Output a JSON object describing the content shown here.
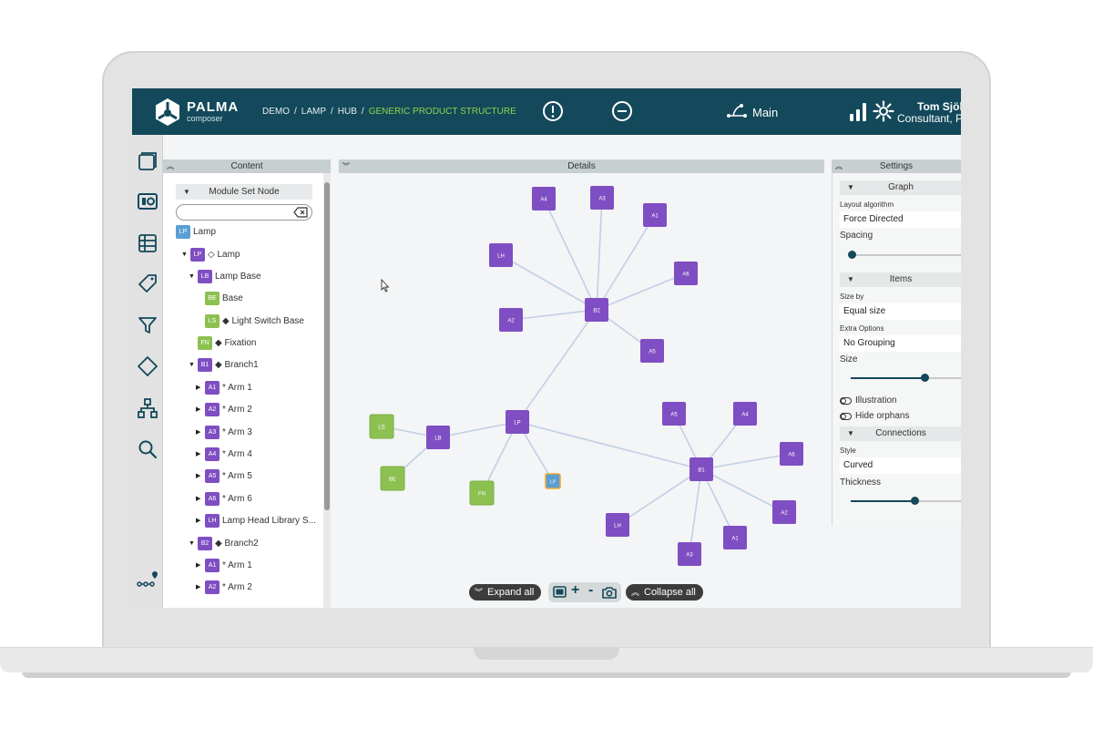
{
  "app": {
    "brand": "PALMA",
    "brand_sub": "composer"
  },
  "breadcrumb": {
    "items": [
      "DEMO",
      "LAMP",
      "HUB"
    ],
    "current": "GENERIC PRODUCT STRUCTURE"
  },
  "header": {
    "branch_label": "Main",
    "user_name": "Tom Sjöb",
    "user_role": "Consultant, P"
  },
  "rail": {
    "icons": [
      "modules-icon",
      "dashboard-icon",
      "table-icon",
      "tag-icon",
      "filter-icon",
      "diamond-icon",
      "hierarchy-icon",
      "search-icon",
      "roadmap-icon"
    ]
  },
  "content": {
    "title": "Content",
    "module_head": "Module Set Node",
    "search_placeholder": "",
    "tree": [
      {
        "badge": "LP",
        "color": "#5a9fd4",
        "label": "Lamp",
        "caret": "",
        "indent": 0
      },
      {
        "badge": "LP",
        "color": "#7f4ec2",
        "label": "◇ Lamp",
        "caret": "▼",
        "indent": 1
      },
      {
        "badge": "LB",
        "color": "#7f4ec2",
        "label": "Lamp Base",
        "caret": "▼",
        "indent": 2
      },
      {
        "badge": "BE",
        "color": "#8cc152",
        "label": "Base",
        "caret": "",
        "indent": 3
      },
      {
        "badge": "LS",
        "color": "#8cc152",
        "label": "◆ Light Switch Base",
        "caret": "",
        "indent": 3
      },
      {
        "badge": "FN",
        "color": "#8cc152",
        "label": "◆ Fixation",
        "caret": "",
        "indent": 2
      },
      {
        "badge": "B1",
        "color": "#7f4ec2",
        "label": "◆ Branch1",
        "caret": "▼",
        "indent": 2
      },
      {
        "badge": "A1",
        "color": "#7f4ec2",
        "label": "* Arm 1",
        "caret": "▶",
        "indent": 3
      },
      {
        "badge": "A2",
        "color": "#7f4ec2",
        "label": "* Arm 2",
        "caret": "▶",
        "indent": 3
      },
      {
        "badge": "A3",
        "color": "#7f4ec2",
        "label": "* Arm 3",
        "caret": "▶",
        "indent": 3
      },
      {
        "badge": "A4",
        "color": "#7f4ec2",
        "label": "* Arm 4",
        "caret": "▶",
        "indent": 3
      },
      {
        "badge": "A5",
        "color": "#7f4ec2",
        "label": "* Arm 5",
        "caret": "▶",
        "indent": 3
      },
      {
        "badge": "A6",
        "color": "#7f4ec2",
        "label": "* Arm 6",
        "caret": "▶",
        "indent": 3
      },
      {
        "badge": "LH",
        "color": "#7f4ec2",
        "label": "Lamp Head Library S...",
        "caret": "▶",
        "indent": 3
      },
      {
        "badge": "B2",
        "color": "#7f4ec2",
        "label": "◆ Branch2",
        "caret": "▼",
        "indent": 2
      },
      {
        "badge": "A1",
        "color": "#7f4ec2",
        "label": "* Arm 1",
        "caret": "▶",
        "indent": 3
      },
      {
        "badge": "A2",
        "color": "#7f4ec2",
        "label": "* Arm 2",
        "caret": "▶",
        "indent": 3
      }
    ]
  },
  "details": {
    "title": "Details",
    "expand_label": "Expand all",
    "collapse_label": "Collapse all",
    "zoom_plus": "+",
    "zoom_minus": "-",
    "nodes": [
      {
        "id": "LP",
        "color": "#7f4ec2"
      },
      {
        "id": "LB",
        "color": "#7f4ec2"
      },
      {
        "id": "LS",
        "color": "#8cc152"
      },
      {
        "id": "BE",
        "color": "#8cc152"
      },
      {
        "id": "FN",
        "color": "#8cc152"
      },
      {
        "id": "LP",
        "color": "#5a9fd4"
      },
      {
        "id": "B2",
        "color": "#7f4ec2"
      },
      {
        "id": "A4",
        "color": "#7f4ec2"
      },
      {
        "id": "A3",
        "color": "#7f4ec2"
      },
      {
        "id": "A1",
        "color": "#7f4ec2"
      },
      {
        "id": "LH",
        "color": "#7f4ec2"
      },
      {
        "id": "A6",
        "color": "#7f4ec2"
      },
      {
        "id": "A2",
        "color": "#7f4ec2"
      },
      {
        "id": "A5",
        "color": "#7f4ec2"
      },
      {
        "id": "B1",
        "color": "#7f4ec2"
      },
      {
        "id": "A5",
        "color": "#7f4ec2"
      },
      {
        "id": "A4",
        "color": "#7f4ec2"
      },
      {
        "id": "A6",
        "color": "#7f4ec2"
      },
      {
        "id": "A2",
        "color": "#7f4ec2"
      },
      {
        "id": "A1",
        "color": "#7f4ec2"
      },
      {
        "id": "A3",
        "color": "#7f4ec2"
      },
      {
        "id": "LH",
        "color": "#7f4ec2"
      }
    ]
  },
  "settings": {
    "title": "Settings",
    "graph_section": "Graph",
    "layout_label": "Layout algorithm",
    "layout_value": "Force Directed",
    "spacing_label": "Spacing",
    "items_section": "Items",
    "size_by_label": "Size by",
    "size_by_value": "Equal size",
    "extra_label": "Extra Options",
    "extra_value": "No Grouping",
    "size_label": "Size",
    "illustration_label": "Illustration",
    "hide_orphans_label": "Hide orphans",
    "connections_section": "Connections",
    "style_label": "Style",
    "style_value": "Curved",
    "thickness_label": "Thickness"
  },
  "colors": {
    "header": "#13495a",
    "accent": "#8fd14f",
    "purple": "#7f4ec2",
    "green": "#8cc152",
    "blue": "#5a9fd4"
  }
}
